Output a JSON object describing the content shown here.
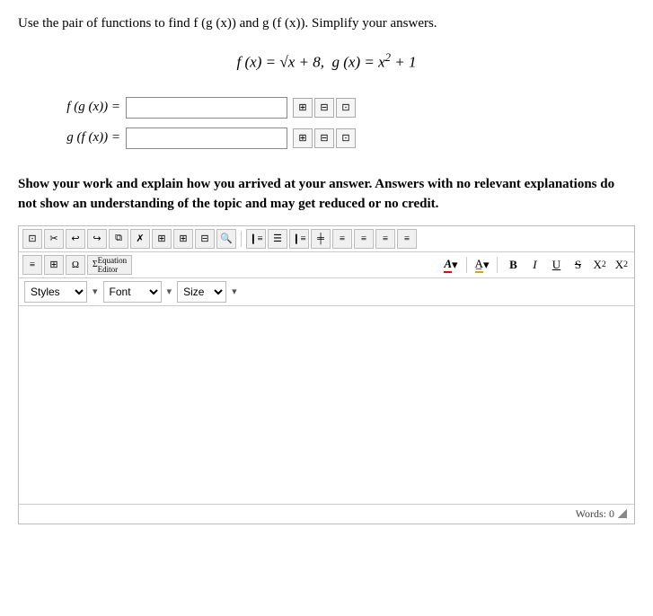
{
  "instructions": "Use the pair of functions to find f (g (x)) and g (f (x)). Simplify your answers.",
  "formula": {
    "display": "f (x) = √x + 8, g (x) = x² + 1"
  },
  "inputs": [
    {
      "id": "fgx",
      "label": "f (g (x)) =",
      "value": "",
      "placeholder": ""
    },
    {
      "id": "gfx",
      "label": "g (f (x)) =",
      "value": "",
      "placeholder": ""
    }
  ],
  "show_work_text": "Show your work and explain how you arrived at your answer. Answers with no relevant explanations do not show an understanding of the topic and may get reduced or no credit.",
  "toolbar": {
    "row1_buttons": [
      "❚❚",
      "✗",
      "←",
      "→",
      "⧉",
      "✗",
      "⊞",
      "⊞",
      "⊟",
      "🔍",
      "❙≡",
      "≡≡",
      "❙≡",
      "╪",
      "❙≡",
      "≡",
      "≡≡",
      "≡",
      "≡"
    ],
    "equation_label": "Equation",
    "editor_label": "Editor",
    "styles_label": "Styles",
    "font_label": "Font",
    "size_label": "Size"
  },
  "editor": {
    "content": "",
    "words_label": "Words: 0"
  }
}
